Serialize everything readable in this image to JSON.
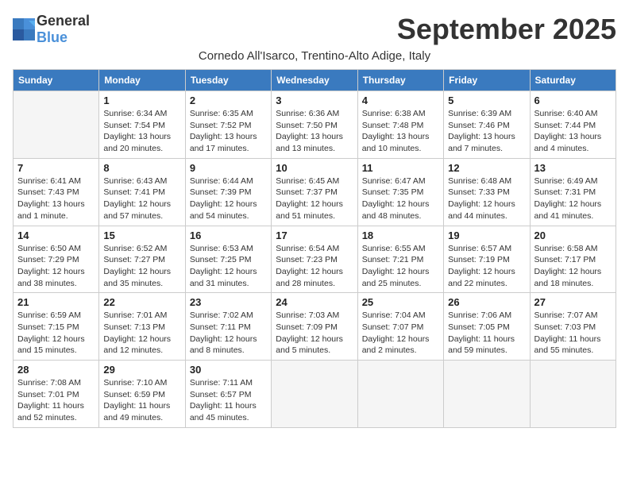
{
  "logo": {
    "general": "General",
    "blue": "Blue"
  },
  "title": "September 2025",
  "subtitle": "Cornedo All'Isarco, Trentino-Alto Adige, Italy",
  "days_of_week": [
    "Sunday",
    "Monday",
    "Tuesday",
    "Wednesday",
    "Thursday",
    "Friday",
    "Saturday"
  ],
  "weeks": [
    [
      {
        "day": "",
        "info": ""
      },
      {
        "day": "1",
        "info": "Sunrise: 6:34 AM\nSunset: 7:54 PM\nDaylight: 13 hours\nand 20 minutes."
      },
      {
        "day": "2",
        "info": "Sunrise: 6:35 AM\nSunset: 7:52 PM\nDaylight: 13 hours\nand 17 minutes."
      },
      {
        "day": "3",
        "info": "Sunrise: 6:36 AM\nSunset: 7:50 PM\nDaylight: 13 hours\nand 13 minutes."
      },
      {
        "day": "4",
        "info": "Sunrise: 6:38 AM\nSunset: 7:48 PM\nDaylight: 13 hours\nand 10 minutes."
      },
      {
        "day": "5",
        "info": "Sunrise: 6:39 AM\nSunset: 7:46 PM\nDaylight: 13 hours\nand 7 minutes."
      },
      {
        "day": "6",
        "info": "Sunrise: 6:40 AM\nSunset: 7:44 PM\nDaylight: 13 hours\nand 4 minutes."
      }
    ],
    [
      {
        "day": "7",
        "info": "Sunrise: 6:41 AM\nSunset: 7:43 PM\nDaylight: 13 hours\nand 1 minute."
      },
      {
        "day": "8",
        "info": "Sunrise: 6:43 AM\nSunset: 7:41 PM\nDaylight: 12 hours\nand 57 minutes."
      },
      {
        "day": "9",
        "info": "Sunrise: 6:44 AM\nSunset: 7:39 PM\nDaylight: 12 hours\nand 54 minutes."
      },
      {
        "day": "10",
        "info": "Sunrise: 6:45 AM\nSunset: 7:37 PM\nDaylight: 12 hours\nand 51 minutes."
      },
      {
        "day": "11",
        "info": "Sunrise: 6:47 AM\nSunset: 7:35 PM\nDaylight: 12 hours\nand 48 minutes."
      },
      {
        "day": "12",
        "info": "Sunrise: 6:48 AM\nSunset: 7:33 PM\nDaylight: 12 hours\nand 44 minutes."
      },
      {
        "day": "13",
        "info": "Sunrise: 6:49 AM\nSunset: 7:31 PM\nDaylight: 12 hours\nand 41 minutes."
      }
    ],
    [
      {
        "day": "14",
        "info": "Sunrise: 6:50 AM\nSunset: 7:29 PM\nDaylight: 12 hours\nand 38 minutes."
      },
      {
        "day": "15",
        "info": "Sunrise: 6:52 AM\nSunset: 7:27 PM\nDaylight: 12 hours\nand 35 minutes."
      },
      {
        "day": "16",
        "info": "Sunrise: 6:53 AM\nSunset: 7:25 PM\nDaylight: 12 hours\nand 31 minutes."
      },
      {
        "day": "17",
        "info": "Sunrise: 6:54 AM\nSunset: 7:23 PM\nDaylight: 12 hours\nand 28 minutes."
      },
      {
        "day": "18",
        "info": "Sunrise: 6:55 AM\nSunset: 7:21 PM\nDaylight: 12 hours\nand 25 minutes."
      },
      {
        "day": "19",
        "info": "Sunrise: 6:57 AM\nSunset: 7:19 PM\nDaylight: 12 hours\nand 22 minutes."
      },
      {
        "day": "20",
        "info": "Sunrise: 6:58 AM\nSunset: 7:17 PM\nDaylight: 12 hours\nand 18 minutes."
      }
    ],
    [
      {
        "day": "21",
        "info": "Sunrise: 6:59 AM\nSunset: 7:15 PM\nDaylight: 12 hours\nand 15 minutes."
      },
      {
        "day": "22",
        "info": "Sunrise: 7:01 AM\nSunset: 7:13 PM\nDaylight: 12 hours\nand 12 minutes."
      },
      {
        "day": "23",
        "info": "Sunrise: 7:02 AM\nSunset: 7:11 PM\nDaylight: 12 hours\nand 8 minutes."
      },
      {
        "day": "24",
        "info": "Sunrise: 7:03 AM\nSunset: 7:09 PM\nDaylight: 12 hours\nand 5 minutes."
      },
      {
        "day": "25",
        "info": "Sunrise: 7:04 AM\nSunset: 7:07 PM\nDaylight: 12 hours\nand 2 minutes."
      },
      {
        "day": "26",
        "info": "Sunrise: 7:06 AM\nSunset: 7:05 PM\nDaylight: 11 hours\nand 59 minutes."
      },
      {
        "day": "27",
        "info": "Sunrise: 7:07 AM\nSunset: 7:03 PM\nDaylight: 11 hours\nand 55 minutes."
      }
    ],
    [
      {
        "day": "28",
        "info": "Sunrise: 7:08 AM\nSunset: 7:01 PM\nDaylight: 11 hours\nand 52 minutes."
      },
      {
        "day": "29",
        "info": "Sunrise: 7:10 AM\nSunset: 6:59 PM\nDaylight: 11 hours\nand 49 minutes."
      },
      {
        "day": "30",
        "info": "Sunrise: 7:11 AM\nSunset: 6:57 PM\nDaylight: 11 hours\nand 45 minutes."
      },
      {
        "day": "",
        "info": ""
      },
      {
        "day": "",
        "info": ""
      },
      {
        "day": "",
        "info": ""
      },
      {
        "day": "",
        "info": ""
      }
    ]
  ]
}
